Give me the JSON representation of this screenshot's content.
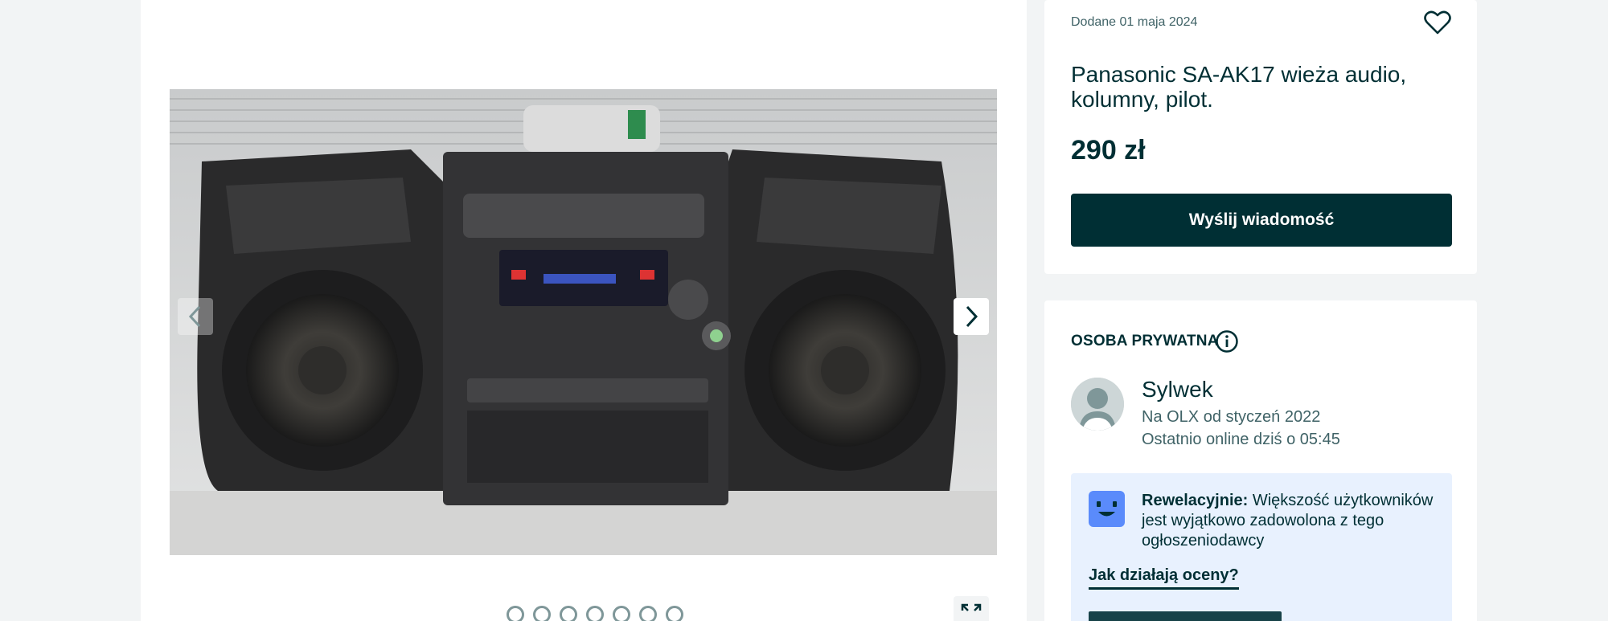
{
  "gallery": {
    "photo_count": 7,
    "active_index": 0,
    "prev_icon": "chevron-left-icon",
    "next_icon": "chevron-right-icon",
    "expand_icon": "expand-icon"
  },
  "ad": {
    "added_date": "Dodane 01 maja 2024",
    "title": "Panasonic SA-AK17 wieża audio, kolumny, pilot.",
    "price": "290 zł",
    "message_button": "Wyślij wiadomość",
    "favorite_icon": "heart-icon"
  },
  "seller": {
    "type_label": "OSOBA PRYWATNA",
    "info_icon": "info-icon",
    "name": "Sylwek",
    "member_since": "Na OLX od styczeń 2022",
    "last_online": "Ostatnio online dziś o 05:45",
    "rating": {
      "title": "Rewelacyjnie:",
      "description": " Większość użytkowników jest wyjątkowo zadowolona z tego ogłoszeniodawcy",
      "link": "Jak działają oceny?",
      "icon": "smiley-icon"
    }
  },
  "colors": {
    "primary": "#002f34",
    "background": "#f2f4f5",
    "rating_bg": "#e8f1fe",
    "rating_icon": "#5a8bfb"
  }
}
